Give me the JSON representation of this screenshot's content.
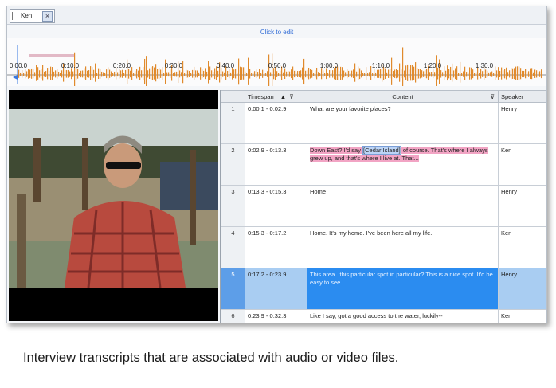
{
  "tab": {
    "label": "Ken",
    "close": "×"
  },
  "media_bar": {
    "click_to_edit": "Click to edit"
  },
  "timeline": {
    "ticks": [
      "0:00.0",
      "0:10.0",
      "0:20.0",
      "0:30.0",
      "0:40.0",
      "0:50.0",
      "1:00.0",
      "1:10.0",
      "1:20.0",
      "1:30.0"
    ]
  },
  "grid": {
    "columns": [
      "",
      "Timespan",
      "Content",
      "Speaker"
    ],
    "rows": [
      {
        "num": "1",
        "timespan": "0:00.1 - 0:02.9",
        "content": "What are your favorite places?",
        "speaker": "Henry"
      },
      {
        "num": "2",
        "timespan": "0:02.9 - 0:13.3",
        "content_pre": "Down East? I'd say ",
        "content_hl": "[Cedar Island]",
        "content_post": " of course. That's where I always grew up, and that's where I live at. That...",
        "speaker": "Ken"
      },
      {
        "num": "3",
        "timespan": "0:13.3 - 0:15.3",
        "content": "Home",
        "speaker": "Henry"
      },
      {
        "num": "4",
        "timespan": "0:15.3 - 0:17.2",
        "content": "Home. It's my home. I've been here all my life.",
        "speaker": "Ken"
      },
      {
        "num": "5",
        "timespan": "0:17.2 - 0:23.9",
        "content": "This area...this particular spot in particular? This is a nice spot. It'd be easy to see...",
        "speaker": "Henry"
      },
      {
        "num": "6",
        "timespan": "0:23.9 - 0:32.3",
        "content": "Like I say, got a good access to the water, luckily--",
        "speaker": "Ken"
      }
    ]
  },
  "caption": "Interview transcripts that are associated with audio or video files."
}
